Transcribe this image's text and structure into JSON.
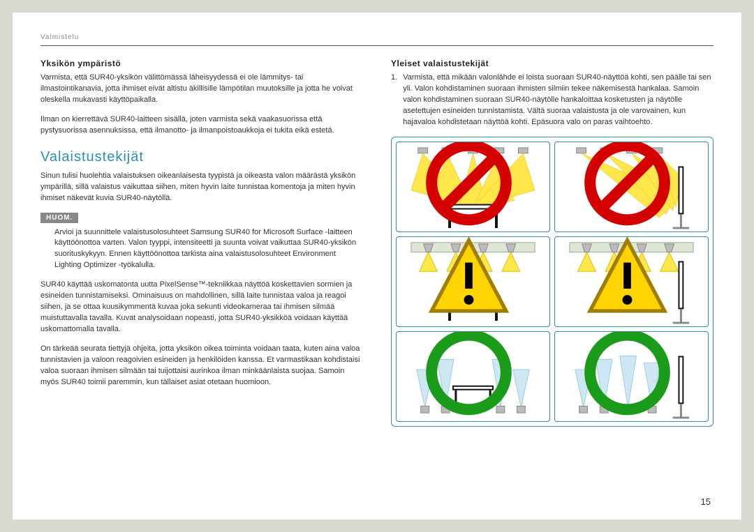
{
  "crumb": "Valmistelu",
  "page_number": "15",
  "left": {
    "h1": "Yksikön ympäristö",
    "p1": "Varmista, että SUR40-yksikön välittömässä läheisyydessä ei ole lämmitys- tai ilmastointikanavia, jotta ihmiset eivät altistu äkillisille lämpötilan muutoksille ja jotta he voivat oleskella mukavasti käyttöpaikalla.",
    "p2": "Ilman on kierrettävä SUR40-laitteen sisällä, joten varmista sekä vaakasuorissa että pystysuorissa asennuksissa, että ilmanotto- ja ilmanpoistoaukkoja ei tukita eikä estetä.",
    "h2": "Valaistustekijät",
    "p3": "Sinun tulisi huolehtia valaistuksen oikeanlaisesta tyypistä ja oikeasta valon määrästä yksikön ympärillä, sillä valaistus vaikuttaa siihen, miten hyvin laite tunnistaa komentoja ja miten hyvin ihmiset näkevät kuvia SUR40-näytöllä.",
    "note_label": "HUOM.",
    "note_p": "Arvioi ja suunnittele valaistusolosuhteet Samsung SUR40 for Microsoft Surface -laitteen käyttöönottoa varten. Valon tyyppi, intensiteetti ja suunta voivat vaikuttaa SUR40-yksikön suorituskykyyn. Ennen käyttöönottoa tarkista aina valaistusolosuhteet Environment Lighting Optimizer -työkalulla.",
    "p4": "SUR40 käyttää uskomatonta uutta PixelSense™-tekniikkaa näyttöä koskettavien sormien ja esineiden tunnistamiseksi. Ominaisuus on mahdollinen, sillä laite tunnistaa valoa ja reagoi siihen, ja se ottaa kuusikymmentä kuvaa joka sekunti videokameraa tai ihmisen silmää muistuttavalla tavalla. Kuvat analysoidaan nopeasti, jotta SUR40-yksikköä voidaan käyttää uskomattomalla tavalla.",
    "p5": "On tärkeää seurata tiettyjä ohjeita, jotta yksikön oikea toiminta voidaan taata, kuten aina valoa tunnistavien ja valoon reagoivien esineiden ja henkilöiden kanssa. Et varmastikaan kohdistaisi valoa suoraan ihmisen silmään tai tuijottaisi aurinkoa ilman minkäänlaista suojaa. Samoin myös SUR40 toimii paremmin, kun tällaiset asiat otetaan huomioon."
  },
  "right": {
    "h1": "Yleiset valaistustekijät",
    "item1_num": "1.",
    "item1_text": "Varmista, että mikään valonlähde ei loista suoraan SUR40-näyttöä kohti, sen päälle tai sen yli. Valon kohdistaminen suoraan ihmisten silmiin tekee näkemisestä hankalaa. Samoin valon kohdistaminen suoraan SUR40-näytölle hankaloittaa kosketusten ja näytölle asetettujen esineiden tunnistamista. Vältä suoraa valaistusta ja ole varovainen, kun hajavaloa kohdistetaan näyttöä kohti. Epäsuora valo on paras vaihtoehto."
  },
  "chart_data": {
    "type": "table",
    "description": "Six lighting-scenario panels (2×3 grid) showing SUR40 in table (left column) and wall-mount (right column) orientations under three lighting conditions",
    "panels": [
      {
        "pos": "row1-left",
        "orientation": "table",
        "lighting": "direct-spotlights-aimed-at-screen",
        "status": "bad"
      },
      {
        "pos": "row1-right",
        "orientation": "wall",
        "lighting": "direct-spotlights-aimed-at-screen",
        "status": "bad"
      },
      {
        "pos": "row2-left",
        "orientation": "table",
        "lighting": "shielded-downlights-angled-away",
        "status": "caution"
      },
      {
        "pos": "row2-right",
        "orientation": "wall",
        "lighting": "shielded-downlights-angled-away",
        "status": "caution"
      },
      {
        "pos": "row3-left",
        "orientation": "table",
        "lighting": "indirect-uplights",
        "status": "good"
      },
      {
        "pos": "row3-right",
        "orientation": "wall",
        "lighting": "indirect-uplights",
        "status": "good"
      }
    ],
    "legend": {
      "bad": "red-no-circle",
      "caution": "yellow-warning-triangle",
      "good": "green-ok-circle"
    }
  }
}
